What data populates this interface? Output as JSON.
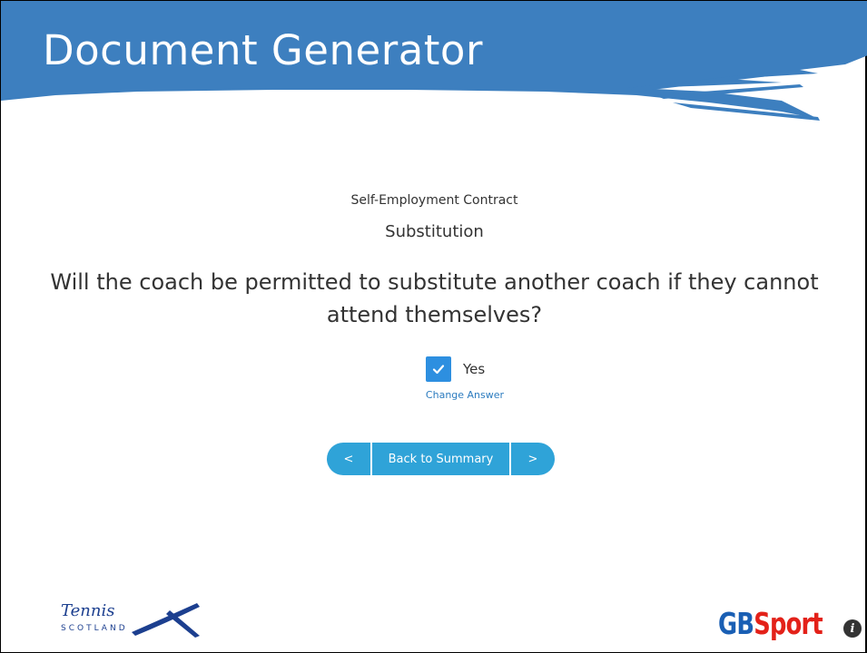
{
  "header": {
    "title": "Document Generator"
  },
  "form": {
    "contract_name": "Self-Employment Contract",
    "section_name": "Substitution",
    "question": "Will the coach be permitted to substitute another coach if they cannot attend themselves?",
    "answer": {
      "label": "Yes",
      "checked": true,
      "change_label": "Change Answer"
    }
  },
  "navigation": {
    "prev_label": "<",
    "summary_label": "Back to Summary",
    "next_label": ">"
  },
  "logos": {
    "tennis": {
      "word": "Tennis",
      "sub": "SCOTLAND"
    },
    "gbsport": {
      "part1": "GB",
      "part2": "Sport",
      "badge": "i"
    }
  },
  "colors": {
    "banner": "#3d7fbf",
    "button": "#2fa3d8",
    "checkbox": "#2d8fe0",
    "link": "#2b7bbf"
  }
}
